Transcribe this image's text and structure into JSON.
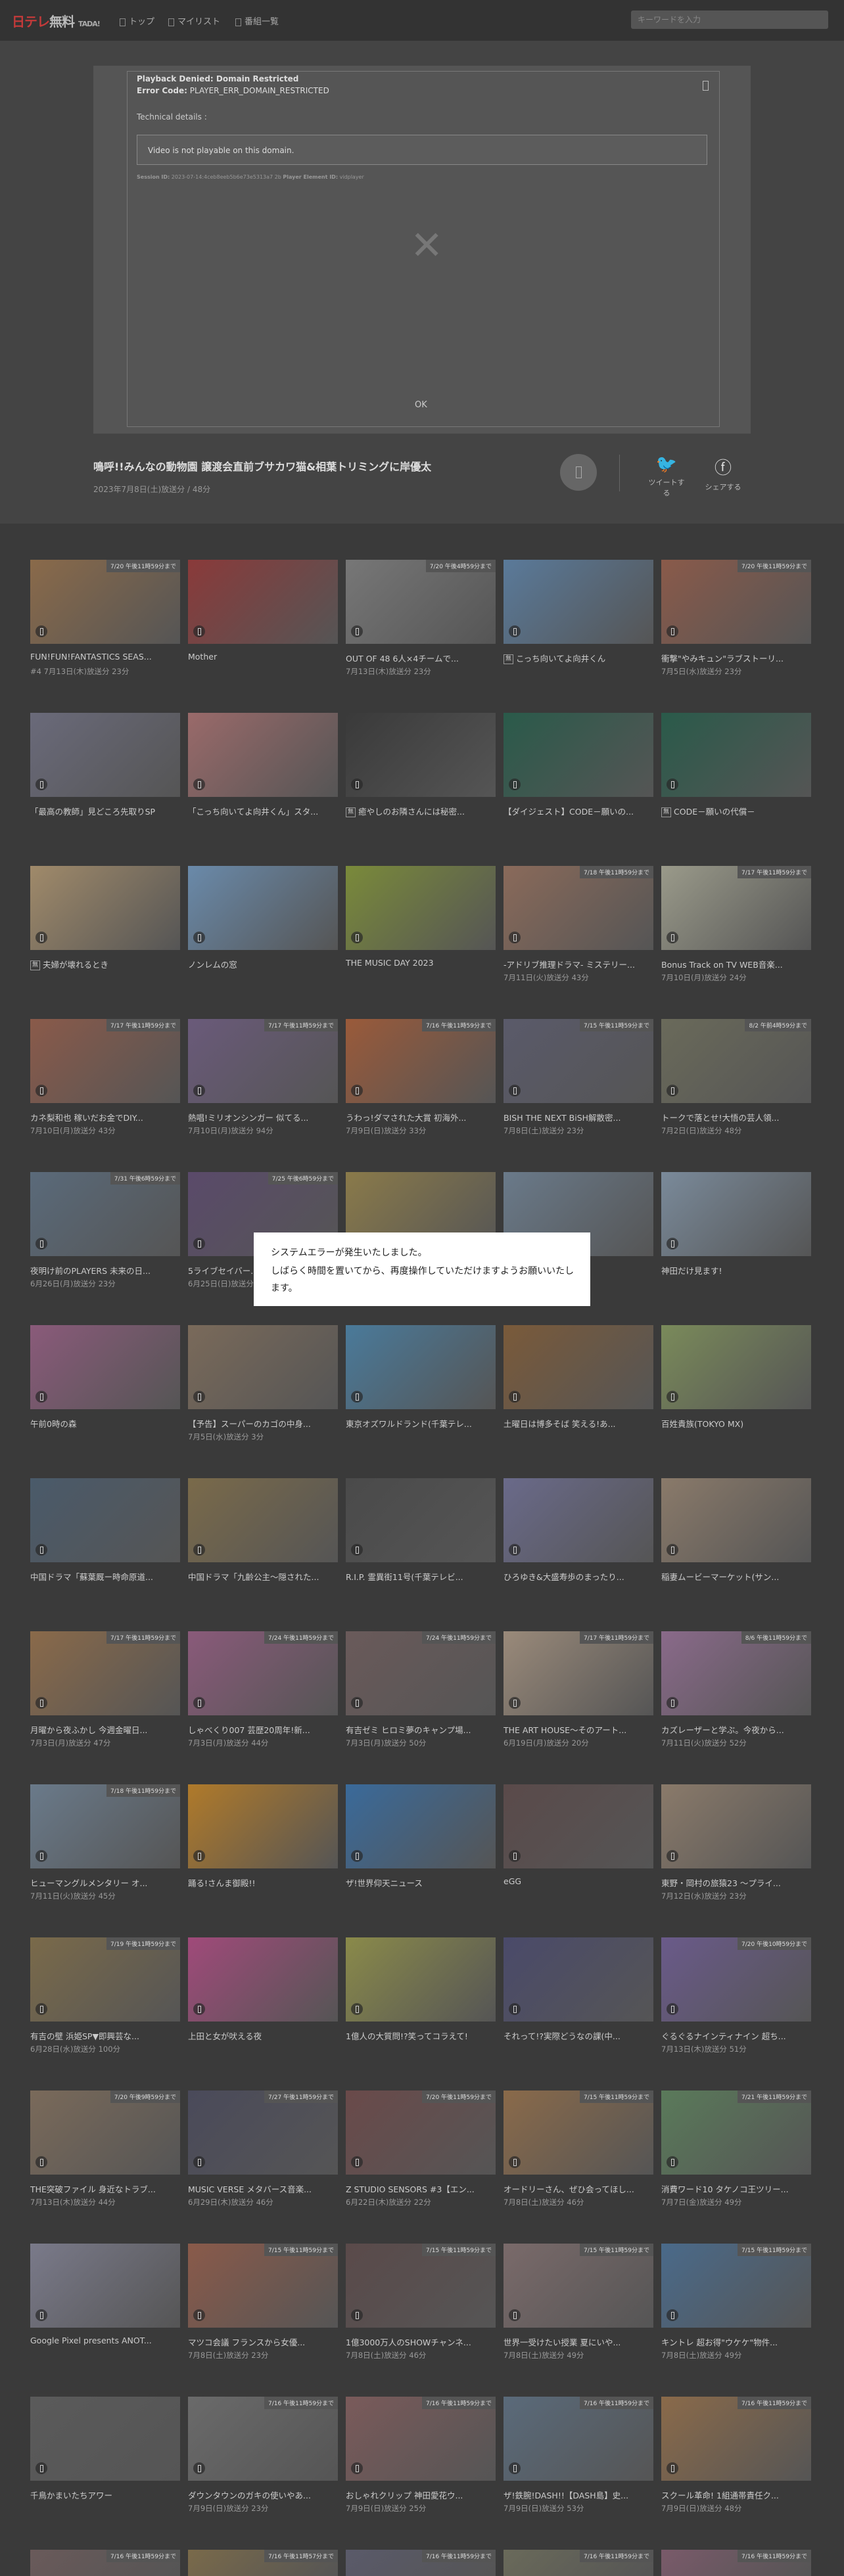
{
  "header": {
    "logo_main": "日テレ",
    "logo_sub": "無料",
    "logo_tag": "TADA!",
    "nav": [
      {
        "label": "トップ",
        "icon": "home-icon"
      },
      {
        "label": "マイリスト",
        "icon": "mylist-icon"
      },
      {
        "label": "番組一覧",
        "icon": "list-icon"
      }
    ],
    "search_placeholder": "キーワードを入力"
  },
  "player_error": {
    "title": "Playback Denied: Domain Restricted",
    "code_label": "Error Code:",
    "code": "PLAYER_ERR_DOMAIN_RESTRICTED",
    "details_label": "Technical details :",
    "detail_message": "Video is not playable on this domain.",
    "session_label": "Session ID:",
    "session_value": "2023-07-14:4ceb8eeb5b6e73e5313a7 2b",
    "player_element_label": "Player Element ID:",
    "player_element_value": "vidplayer",
    "close_glyph": "✕",
    "ok_label": "OK"
  },
  "video": {
    "title": "鳴呼!!みんなの動物園 譲渡会直前ブサカワ猫&相葉トリミングに岸優太",
    "date": "2023年7月8日(土)放送分 / 48分"
  },
  "share": {
    "tweet_label": "ツイートする",
    "fb_label": "シェアする",
    "tweet_icon": "twitter-icon",
    "fb_icon": "facebook-icon"
  },
  "system_error": {
    "line1": "システムエラーが発生いたしました。",
    "line2": "しばらく時間を置いてから、再度操作していただけますようお願いいたします。"
  },
  "cards": [
    {
      "title": "FUN!FUN!FANTASTICS SEAS...",
      "date": "#4 7月13日(木)放送分 23分",
      "tag": "7/20 午後11時59分まで",
      "color": "#8a6a4a",
      "badge": ""
    },
    {
      "title": "Mother",
      "date": "",
      "tag": "",
      "color": "#8a3a3a",
      "badge": ""
    },
    {
      "title": "OUT OF 48 6人×4チームで...",
      "date": "7月13日(木)放送分 23分",
      "tag": "7/20 午後4時59分まで",
      "color": "#777",
      "badge": ""
    },
    {
      "title": "こっち向いてよ向井くん",
      "date": "",
      "tag": "",
      "color": "#5a7a9a",
      "badge": "無"
    },
    {
      "title": "衝撃\"やみキュン\"ラブストーリ...",
      "date": "7月5日(水)放送分 23分",
      "tag": "7/20 午後11時59分まで",
      "color": "#8a5a4a",
      "badge": ""
    },
    {
      "title": "「最高の教師」見どころ先取りSP",
      "date": "",
      "tag": "",
      "color": "#6a6a7a",
      "badge": ""
    },
    {
      "title": "「こっち向いてよ向井くん」スタ...",
      "date": "",
      "tag": "",
      "color": "#9a6a6a",
      "badge": ""
    },
    {
      "title": "癒やしのお隣さんには秘密...",
      "date": "",
      "tag": "",
      "color": "#3a3a3a",
      "badge": "無"
    },
    {
      "title": "【ダイジェスト】CODE－願いの...",
      "date": "",
      "tag": "",
      "color": "#2a5a4a",
      "badge": ""
    },
    {
      "title": "CODE－願いの代償－",
      "date": "",
      "tag": "",
      "color": "#2a5a4a",
      "badge": "無"
    },
    {
      "title": "夫婦が壊れるとき",
      "date": "",
      "tag": "",
      "color": "#a08a6a",
      "badge": "無"
    },
    {
      "title": "ノンレムの窓",
      "date": "",
      "tag": "",
      "color": "#6a8aaa",
      "badge": ""
    },
    {
      "title": "THE MUSIC DAY 2023",
      "date": "",
      "tag": "",
      "color": "#7a8a3a",
      "badge": ""
    },
    {
      "title": "-アドリブ推理ドラマ- ミステリー...",
      "date": "7月11日(火)放送分 43分",
      "tag": "7/18 午後11時59分まで",
      "color": "#8a6a5a",
      "badge": ""
    },
    {
      "title": "Bonus Track on TV WEB音楽...",
      "date": "7月10日(月)放送分 24分",
      "tag": "7/17 午後11時59分まで",
      "color": "#9a9a8a",
      "badge": ""
    },
    {
      "title": "カネ梨和也 稼いだお金でDIY...",
      "date": "7月10日(月)放送分 43分",
      "tag": "7/17 午後11時59分まで",
      "color": "#8a5a4a",
      "badge": ""
    },
    {
      "title": "熱唱!ミリオンシンガー 似てる...",
      "date": "7月10日(月)放送分 94分",
      "tag": "7/17 午後11時59分まで",
      "color": "#6a5a7a",
      "badge": ""
    },
    {
      "title": "うわっ!ダマされた大賞 初海外...",
      "date": "7月9日(日)放送分 33分",
      "tag": "7/16 午後11時59分まで",
      "color": "#9a5a3a",
      "badge": ""
    },
    {
      "title": "BISH THE NEXT BiSH解散密...",
      "date": "7月8日(土)放送分 23分",
      "tag": "7/15 午後11時59分まで",
      "color": "#5a5a6a",
      "badge": ""
    },
    {
      "title": "トークで落とせ!大悟の芸人領...",
      "date": "7月2日(日)放送分 48分",
      "tag": "8/2 午前4時59分まで",
      "color": "#6a6a5a",
      "badge": ""
    },
    {
      "title": "夜明け前のPLAYERS 未来の日...",
      "date": "6月26日(月)放送分 23分",
      "tag": "7/31 午後6時59分まで",
      "color": "#5a6a7a",
      "badge": ""
    },
    {
      "title": "5ライブセイバー...",
      "date": "6月25日(日)放送分",
      "tag": "7/25 午後6時59分まで",
      "color": "#5a4a6a",
      "badge": ""
    },
    {
      "title": "",
      "date": "",
      "tag": "",
      "color": "#8a7a4a",
      "badge": ""
    },
    {
      "title": "",
      "date": "",
      "tag": "",
      "color": "#6a7a8a",
      "badge": ""
    },
    {
      "title": "神田だけ見ます!",
      "date": "",
      "tag": "",
      "color": "#7a8a9a",
      "badge": ""
    },
    {
      "title": "午前0時の森",
      "date": "",
      "tag": "",
      "color": "#8a5a7a",
      "badge": ""
    },
    {
      "title": "【予告】スーパーのカゴの中身...",
      "date": "7月5日(水)放送分 3分",
      "tag": "",
      "color": "#7a6a5a",
      "badge": ""
    },
    {
      "title": "東京オズワルドランド(千葉テレ...",
      "date": "",
      "tag": "",
      "color": "#4a7a9a",
      "badge": ""
    },
    {
      "title": "土曜日は博多そば 笑える!あ...",
      "date": "",
      "tag": "",
      "color": "#7a5a3a",
      "badge": ""
    },
    {
      "title": "百姓貴族(TOKYO MX)",
      "date": "",
      "tag": "",
      "color": "#7a8a5a",
      "badge": ""
    },
    {
      "title": "中国ドラマ「蘇葉厩ー時命原道...",
      "date": "",
      "tag": "",
      "color": "#4a5a6a",
      "badge": ""
    },
    {
      "title": "中国ドラマ「九齡公主〜隠された...",
      "date": "",
      "tag": "",
      "color": "#7a6a4a",
      "badge": ""
    },
    {
      "title": "R.I.P. 霊異街11号(千葉テレビ...",
      "date": "",
      "tag": "",
      "color": "#4a4a4a",
      "badge": ""
    },
    {
      "title": "ひろゆき&大盛寿歩のまったり...",
      "date": "",
      "tag": "",
      "color": "#6a6a8a",
      "badge": ""
    },
    {
      "title": "稲妻ムービーマーケット(サン...",
      "date": "",
      "tag": "",
      "color": "#8a7a6a",
      "badge": ""
    },
    {
      "title": "月曜から夜ふかし 今週金曜日...",
      "date": "7月3日(月)放送分 47分",
      "tag": "7/17 午後11時59分まで",
      "color": "#8a6a4a",
      "badge": ""
    },
    {
      "title": "しゃべくり007 芸歴20周年!新...",
      "date": "7月3日(月)放送分 44分",
      "tag": "7/24 午後11時59分まで",
      "color": "#8a5a7a",
      "badge": ""
    },
    {
      "title": "有吉ゼミ ヒロミ夢のキャンプ場...",
      "date": "7月3日(月)放送分 50分",
      "tag": "7/24 午後11時59分まで",
      "color": "#6a5a5a",
      "badge": ""
    },
    {
      "title": "THE ART HOUSE～そのアート...",
      "date": "6月19日(月)放送分 20分",
      "tag": "7/17 午後11時59分まで",
      "color": "#9a8a7a",
      "badge": ""
    },
    {
      "title": "カズレーザーと学ぶ。今夜から...",
      "date": "7月11日(火)放送分 52分",
      "tag": "8/6 午後11時59分まで",
      "color": "#8a6a8a",
      "badge": ""
    },
    {
      "title": "ヒューマングルメンタリー オ...",
      "date": "7月11日(火)放送分 45分",
      "tag": "7/18 午後11時59分まで",
      "color": "#6a7a8a",
      "badge": ""
    },
    {
      "title": "踊る!さんま御殿!!",
      "date": "",
      "tag": "",
      "color": "#b07a2a",
      "badge": ""
    },
    {
      "title": "ザ!世界仰天ニュース",
      "date": "",
      "tag": "",
      "color": "#3a6a9a",
      "badge": ""
    },
    {
      "title": "eGG",
      "date": "",
      "tag": "",
      "color": "#5a4a4a",
      "badge": ""
    },
    {
      "title": "東野・岡村の旅猿23 ～プライ...",
      "date": "7月12日(水)放送分 23分",
      "tag": "",
      "color": "#8a7a6a",
      "badge": ""
    },
    {
      "title": "有吉の壁 浜姫SP▼即興芸な...",
      "date": "6月28日(水)放送分 100分",
      "tag": "7/19 午後11時59分まで",
      "color": "#7a6a4a",
      "badge": ""
    },
    {
      "title": "上田と女が吠える夜",
      "date": "",
      "tag": "",
      "color": "#a04a7a",
      "badge": ""
    },
    {
      "title": "1億人の大質問!?笑ってコラえて!",
      "date": "",
      "tag": "",
      "color": "#8a8a4a",
      "badge": ""
    },
    {
      "title": "それって!?実際どうなの課(中...",
      "date": "",
      "tag": "",
      "color": "#4a4a6a",
      "badge": ""
    },
    {
      "title": "ぐるぐるナインティナイン 超ち...",
      "date": "7月13日(木)放送分 51分",
      "tag": "7/20 午後10時59分まで",
      "color": "#6a5a8a",
      "badge": ""
    },
    {
      "title": "THE突破ファイル 身近なトラブ...",
      "date": "7月13日(木)放送分 44分",
      "tag": "7/20 午後9時59分まで",
      "color": "#7a6a5a",
      "badge": ""
    },
    {
      "title": "MUSIC VERSE メタバース音楽...",
      "date": "6月29日(木)放送分 46分",
      "tag": "7/27 午後11時59分まで",
      "color": "#4a4a5a",
      "badge": ""
    },
    {
      "title": "Z STUDIO SENSORS #3【エン...",
      "date": "6月22日(木)放送分 22分",
      "tag": "7/20 午後11時59分まで",
      "color": "#6a4a4a",
      "badge": ""
    },
    {
      "title": "オードリーさん、ぜひ会ってほし...",
      "date": "7月8日(土)放送分 46分",
      "tag": "7/15 午後11時59分まで",
      "color": "#8a6a4a",
      "badge": ""
    },
    {
      "title": "消費ワード10 タケノコ王ツリー...",
      "date": "7月7日(金)放送分 49分",
      "tag": "7/21 午後11時59分まで",
      "color": "#5a7a5a",
      "badge": ""
    },
    {
      "title": "Google Pixel presents ANOT...",
      "date": "",
      "tag": "",
      "color": "#7a7a8a",
      "badge": ""
    },
    {
      "title": "マツコ会議 フランスから女優...",
      "date": "7月8日(土)放送分 23分",
      "tag": "7/15 午後11時59分まで",
      "color": "#8a5a4a",
      "badge": ""
    },
    {
      "title": "1億3000万人のSHOWチャンネ...",
      "date": "7月8日(土)放送分 46分",
      "tag": "7/15 午後11時59分まで",
      "color": "#5a4a4a",
      "badge": ""
    },
    {
      "title": "世界一受けたい授業 夏にいや...",
      "date": "7月8日(土)放送分 49分",
      "tag": "7/15 午後11時59分まで",
      "color": "#7a6a6a",
      "badge": ""
    },
    {
      "title": "キントレ 超お得\"ウケケ\"物件...",
      "date": "7月8日(土)放送分 49分",
      "tag": "7/15 午後11時59分まで",
      "color": "#4a6a8a",
      "badge": ""
    },
    {
      "title": "千鳥かまいたちアワー",
      "date": "",
      "tag": "",
      "color": "#5a5a5a",
      "badge": ""
    },
    {
      "title": "ダウンタウンのガキの使いやあ...",
      "date": "7月9日(日)放送分 23分",
      "tag": "7/16 午後11時59分まで",
      "color": "#6a6a6a",
      "badge": ""
    },
    {
      "title": "おしゃれクリップ 神田愛花ウ...",
      "date": "7月9日(日)放送分 25分",
      "tag": "7/16 午後11時59分まで",
      "color": "#7a5a5a",
      "badge": ""
    },
    {
      "title": "ザ!鉄腕!DASH!!【DASH島】史...",
      "date": "7月9日(日)放送分 53分",
      "tag": "7/16 午後11時59分まで",
      "color": "#5a6a7a",
      "badge": ""
    },
    {
      "title": "スクール革命! 1組通帯責任ク...",
      "date": "7月9日(日)放送分 48分",
      "tag": "7/16 午後11時59分まで",
      "color": "#8a6a4a",
      "badge": ""
    }
  ],
  "cards_bottom": [
    {
      "tag": "7/16 午後11時59分まで",
      "color": "#6a5a5a"
    },
    {
      "tag": "7/16 午後11時57分まで",
      "color": "#7a6a4a"
    },
    {
      "tag": "7/16 午後11時59分まで",
      "color": "#5a5a6a"
    },
    {
      "tag": "7/16 午後11時59分まで",
      "color": "#6a6a5a"
    },
    {
      "tag": "7/16 午後11時59分まで",
      "color": "#7a5a6a"
    }
  ]
}
